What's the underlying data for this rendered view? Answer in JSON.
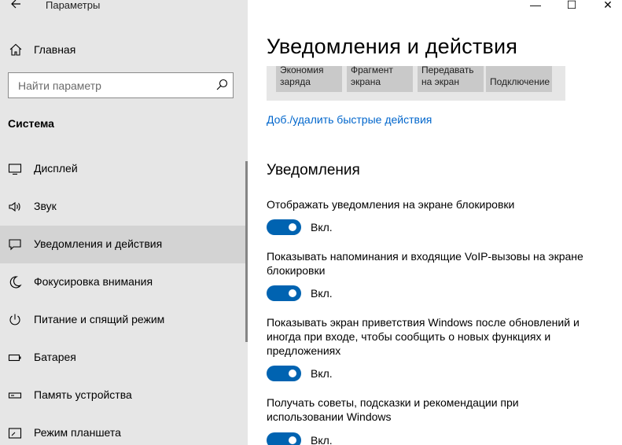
{
  "window": {
    "title": "Параметры",
    "controls": {
      "minimize": "—",
      "maximize": "☐",
      "close": "✕"
    }
  },
  "sidebar": {
    "home_label": "Главная",
    "search_placeholder": "Найти параметр",
    "section_title": "Система",
    "items": [
      {
        "label": "Дисплей",
        "icon": "display-icon",
        "active": false
      },
      {
        "label": "Звук",
        "icon": "sound-icon",
        "active": false
      },
      {
        "label": "Уведомления и действия",
        "icon": "notifications-icon",
        "active": true
      },
      {
        "label": "Фокусировка внимания",
        "icon": "focus-assist-icon",
        "active": false
      },
      {
        "label": "Питание и спящий режим",
        "icon": "power-icon",
        "active": false
      },
      {
        "label": "Батарея",
        "icon": "battery-icon",
        "active": false
      },
      {
        "label": "Память устройства",
        "icon": "storage-icon",
        "active": false
      },
      {
        "label": "Режим планшета",
        "icon": "tablet-mode-icon",
        "active": false
      }
    ]
  },
  "main": {
    "title": "Уведомления и действия",
    "quick_actions": [
      {
        "line1": "Экономия",
        "line2": "заряда"
      },
      {
        "line1": "Фрагмент",
        "line2": "экрана"
      },
      {
        "line1": "Передавать",
        "line2": "на экран"
      },
      {
        "line1": "",
        "line2": "Подключение"
      }
    ],
    "add_remove_link": "Доб./удалить быстрые действия",
    "notifications_heading": "Уведомления",
    "settings": [
      {
        "label": "Отображать уведомления на экране блокировки",
        "state": "Вкл.",
        "on": true
      },
      {
        "label": "Показывать напоминания и входящие VoIP-вызовы на экране блокировки",
        "state": "Вкл.",
        "on": true
      },
      {
        "label": "Показывать экран приветствия Windows после обновлений и иногда при входе, чтобы сообщить о новых функциях и предложениях",
        "state": "Вкл.",
        "on": true
      },
      {
        "label": "Получать советы, подсказки и рекомендации при использовании Windows",
        "state": "Вкл.",
        "on": true
      }
    ]
  },
  "colors": {
    "accent": "#0063b1",
    "link": "#0066cc",
    "sidebar_bg": "#e6e6e6",
    "active_item_bg": "#d3d3d3"
  }
}
